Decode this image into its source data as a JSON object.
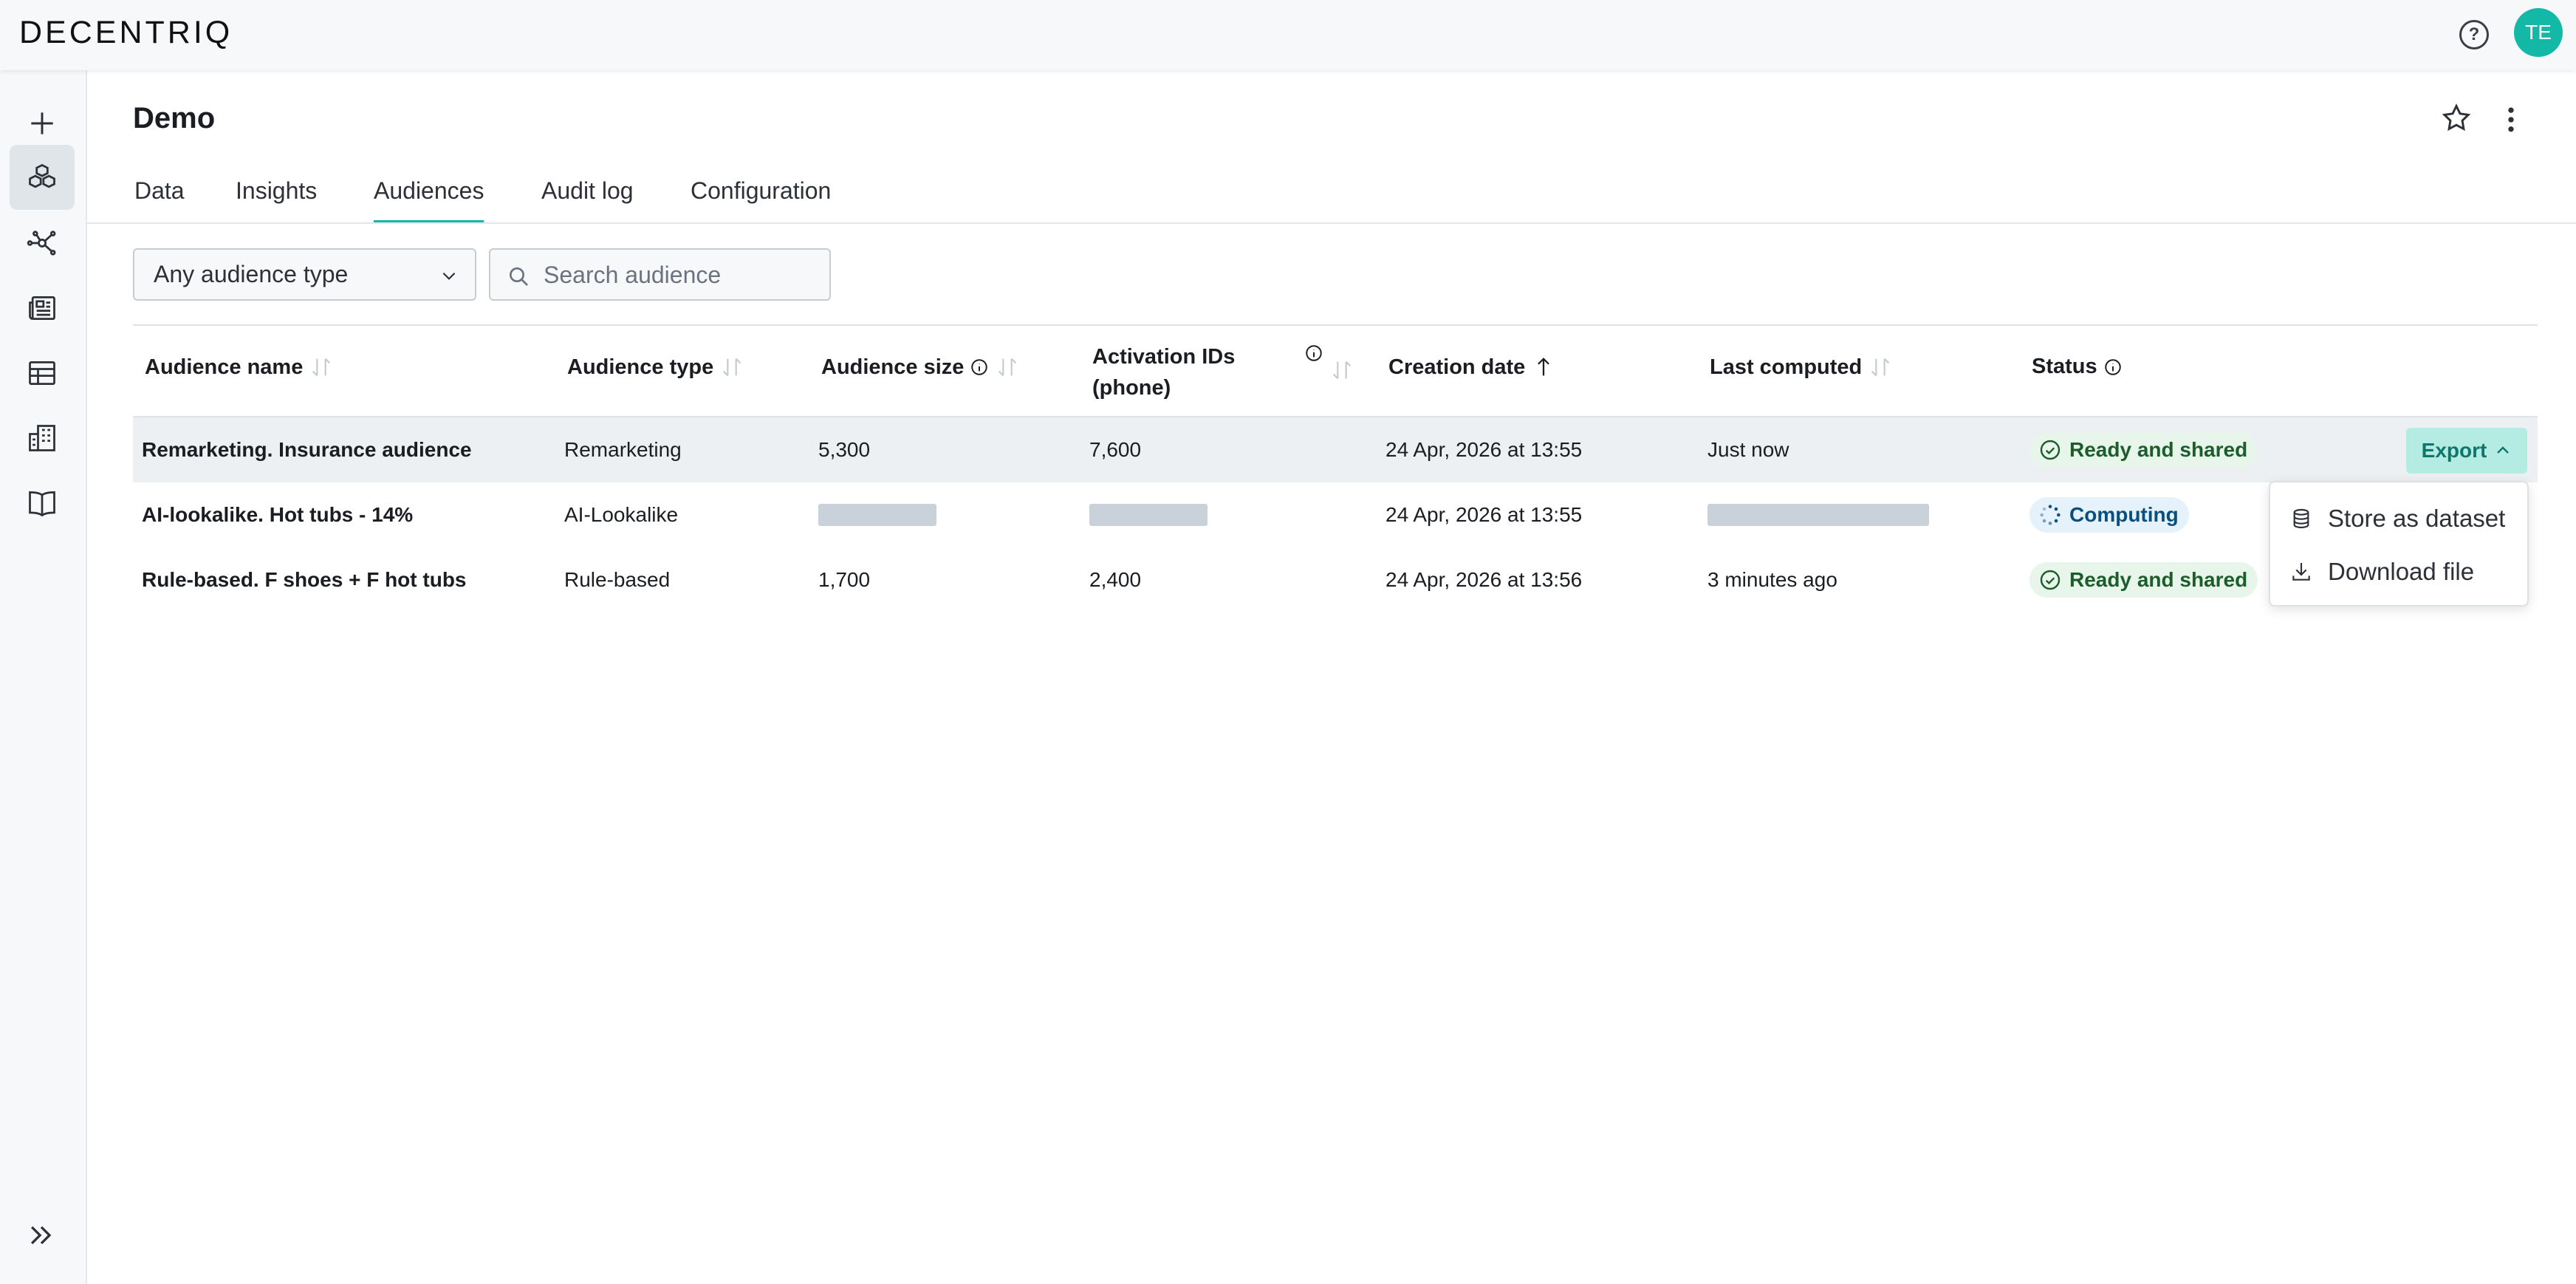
{
  "app": {
    "logo": "DECENTRIQ",
    "help_glyph": "?",
    "avatar_initials": "TE",
    "accent_color": "#14b8a6"
  },
  "sidebar": {
    "items": [
      {
        "icon": "plus-icon"
      },
      {
        "icon": "cubes-icon",
        "active": true
      },
      {
        "icon": "network-icon"
      },
      {
        "icon": "newspaper-icon"
      },
      {
        "icon": "table-icon"
      },
      {
        "icon": "building-icon"
      },
      {
        "icon": "book-icon"
      }
    ],
    "collapse_icon": "double-chevron-right-icon"
  },
  "page": {
    "title": "Demo",
    "tabs": [
      {
        "label": "Data"
      },
      {
        "label": "Insights"
      },
      {
        "label": "Audiences",
        "active": true
      },
      {
        "label": "Audit log"
      },
      {
        "label": "Configuration"
      }
    ]
  },
  "filters": {
    "type_select_value": "Any audience type",
    "search_placeholder": "Search audience"
  },
  "table": {
    "columns": [
      {
        "label": "Audience name",
        "sortable": true
      },
      {
        "label": "Audience type",
        "sortable": true
      },
      {
        "label": "Audience size",
        "info": true,
        "sortable": true
      },
      {
        "label": "Activation IDs",
        "label2": "(phone)",
        "info": true,
        "sortable": true
      },
      {
        "label": "Creation date",
        "sorted": "asc"
      },
      {
        "label": "Last computed",
        "sortable": true
      },
      {
        "label": "Status",
        "info": true
      }
    ],
    "rows": [
      {
        "name": "Remarketing. Insurance audience",
        "type": "Remarketing",
        "size": "5,300",
        "activation_ids": "7,600",
        "created": "24 Apr, 2026 at 13:55",
        "last_computed": "Just now",
        "status": "Ready and shared",
        "status_kind": "ready",
        "selected": true
      },
      {
        "name": "AI-lookalike. Hot tubs - 14%",
        "type": "AI-Lookalike",
        "size": "",
        "activation_ids": "",
        "created": "24 Apr, 2026 at 13:55",
        "last_computed": "",
        "status": "Computing",
        "status_kind": "computing",
        "loading": true
      },
      {
        "name": "Rule-based. F shoes + F hot tubs",
        "type": "Rule-based",
        "size": "1,700",
        "activation_ids": "2,400",
        "created": "24 Apr, 2026 at 13:56",
        "last_computed": "3 minutes ago",
        "status": "Ready and shared",
        "status_kind": "ready"
      }
    ]
  },
  "export": {
    "button_label": "Export",
    "menu": [
      {
        "label": "Store as dataset",
        "icon": "database-icon"
      },
      {
        "label": "Download file",
        "icon": "download-icon"
      }
    ]
  }
}
